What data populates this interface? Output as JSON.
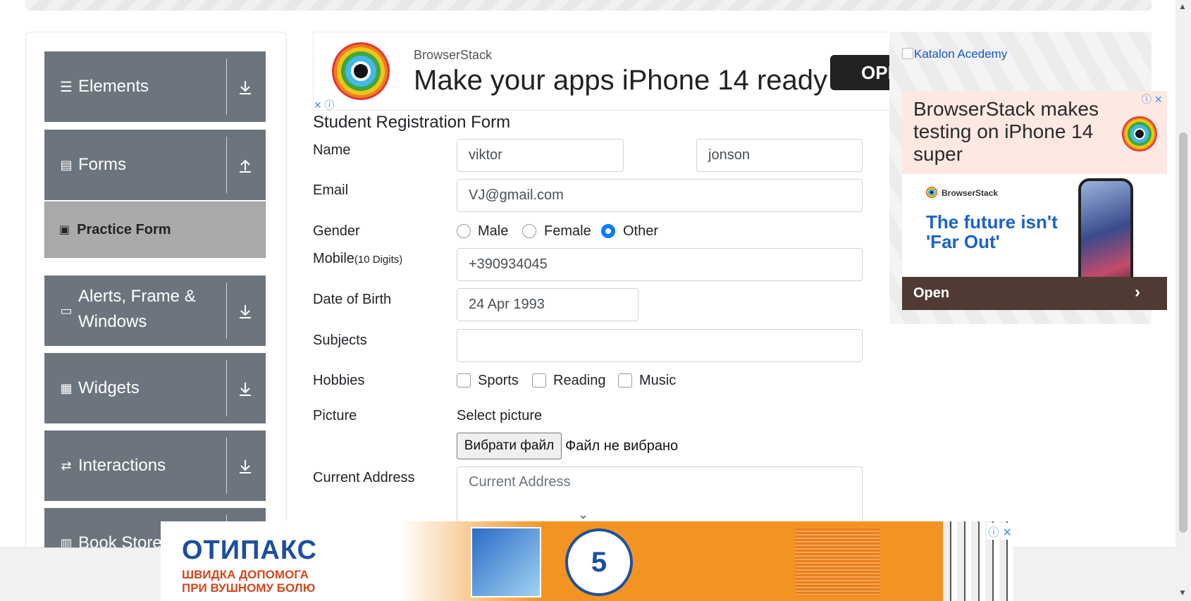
{
  "sidebar": {
    "groups": [
      {
        "label": "Elements",
        "icon": "list-icon"
      },
      {
        "label": "Forms",
        "icon": "document-icon"
      },
      {
        "label": "Alerts, Frame & Windows",
        "icon": "window-icon"
      },
      {
        "label": "Widgets",
        "icon": "widgets-icon"
      },
      {
        "label": "Interactions",
        "icon": "interactions-icon"
      },
      {
        "label": "Book Store",
        "icon": "books-icon"
      }
    ],
    "active_item": {
      "label": "Practice Form",
      "icon": "html5-icon"
    }
  },
  "top_ad": {
    "brand": "BrowserStack",
    "headline": "Make your apps iPhone 14 ready",
    "button": "OPEN"
  },
  "right_ad": {
    "broken_image_alt": "Katalon Acedemy",
    "headline": "BrowserStack makes testing on iPhone 14 super",
    "brand": "BrowserStack",
    "tagline": "The future isn't 'Far Out'",
    "cta": "Open"
  },
  "form": {
    "title": "Student Registration Form",
    "labels": {
      "name": "Name",
      "email": "Email",
      "gender": "Gender",
      "mobile": "Mobile",
      "mobile_hint": "(10 Digits)",
      "dob": "Date of Birth",
      "subjects": "Subjects",
      "hobbies": "Hobbies",
      "picture": "Picture",
      "address": "Current Address"
    },
    "first_name": "viktor",
    "last_name": "jonson",
    "email": "VJ@gmail.com",
    "gender_options": [
      "Male",
      "Female",
      "Other"
    ],
    "gender_selected": "Other",
    "mobile": "+390934045",
    "dob": "24 Apr 1993",
    "subjects": "",
    "hobbies": [
      "Sports",
      "Reading",
      "Music"
    ],
    "picture_label": "Select picture",
    "file_button": "Вибрати файл",
    "file_status": "Файл не вибрано",
    "address_placeholder": "Current Address"
  },
  "bottom_ad": {
    "brand": "ОТИПАКС",
    "tagline": "ШВИДКА ДОПОМОГА\nПРИ ВУШНОМУ БОЛЮ",
    "badge_number": "5"
  }
}
